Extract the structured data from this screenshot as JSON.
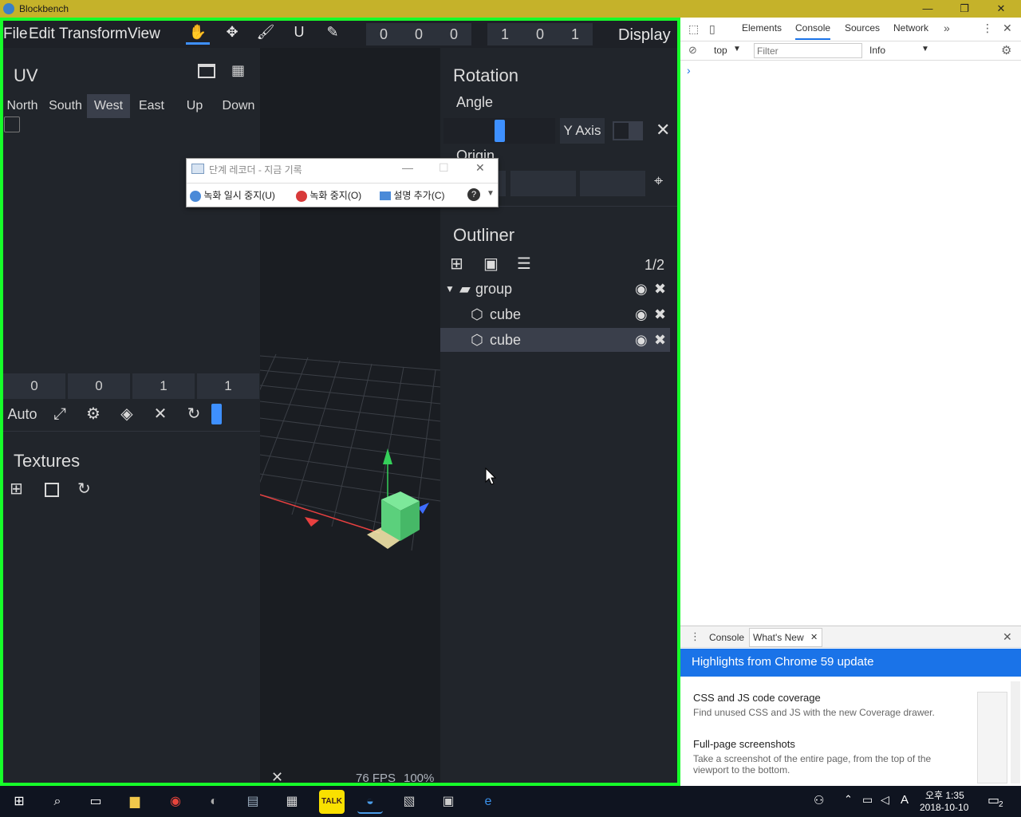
{
  "window": {
    "title": "Blockbench",
    "min": "—",
    "max": "❐",
    "close": "✕"
  },
  "menu": {
    "items": [
      "File",
      "Edit",
      "Transform",
      "View"
    ],
    "display_label": "Display"
  },
  "toolbar": {
    "size_values": [
      "0",
      "0",
      "0"
    ],
    "pos_values": [
      "1",
      "0",
      "1"
    ]
  },
  "uv": {
    "title": "UV",
    "faces": [
      "North",
      "South",
      "West",
      "East",
      "Up",
      "Down"
    ],
    "active_face": "West",
    "uv_values": [
      "0",
      "0",
      "1",
      "1"
    ],
    "auto_label": "Auto"
  },
  "textures": {
    "title": "Textures"
  },
  "viewport": {
    "fps": "76 FPS",
    "zoom": "100%"
  },
  "rotation": {
    "title": "Rotation",
    "angle_label": "Angle",
    "axis": "Y Axis",
    "origin_label": "Origin"
  },
  "outliner": {
    "title": "Outliner",
    "count": "1/2",
    "items": [
      {
        "label": "group",
        "type": "group"
      },
      {
        "label": "cube",
        "type": "cube"
      },
      {
        "label": "cube",
        "type": "cube"
      }
    ]
  },
  "recorder": {
    "title": "단계 레코더 - 지금 기록",
    "pause": "녹화 일시 중지(U)",
    "stop": "녹화 중지(O)",
    "comment": "설명 추가(C)"
  },
  "devtools": {
    "tabs": [
      "Elements",
      "Console",
      "Sources",
      "Network"
    ],
    "active_tab": "Console",
    "context": "top",
    "filter_placeholder": "Filter",
    "level": "Info",
    "prompt": "›",
    "drawer_tabs": [
      "Console",
      "What's New"
    ],
    "highlights_title": "Highlights from Chrome 59 update",
    "features": [
      {
        "title": "CSS and JS code coverage",
        "desc": "Find unused CSS and JS with the new Coverage drawer."
      },
      {
        "title": "Full-page screenshots",
        "desc": "Take a screenshot of the entire page, from the top of the viewport to the bottom."
      }
    ]
  },
  "taskbar": {
    "time": "오후 1:35",
    "date": "2018-10-10",
    "notif_count": "2",
    "ime": "A"
  },
  "colors": {
    "frame": "#17ff2a",
    "accent": "#3e90ff",
    "titlebar": "#c5b22a"
  }
}
